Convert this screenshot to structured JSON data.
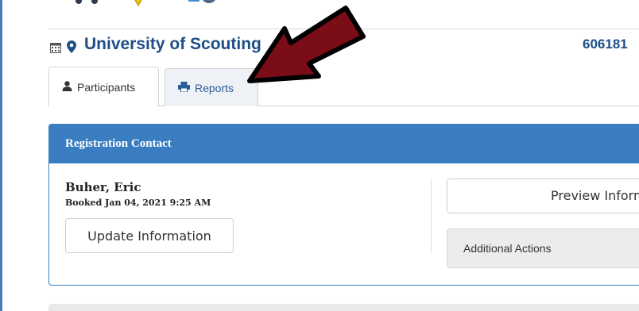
{
  "event": {
    "title": "University of Scouting",
    "id": "606181"
  },
  "tabs": [
    {
      "label": "Participants",
      "icon": "user-icon",
      "active": true
    },
    {
      "label": "Reports",
      "icon": "printer-icon",
      "active": false
    }
  ],
  "registration": {
    "header": "Registration Contact",
    "name": "Buher, Eric",
    "booked": "Booked Jan 04, 2021 9:25 AM",
    "update_label": "Update Information",
    "preview_label": "Preview Information",
    "actions_label": "Additional Actions"
  },
  "colors": {
    "primary": "#3a7dc0",
    "title": "#1e4e87",
    "arrow_fill": "#7a0d18"
  }
}
